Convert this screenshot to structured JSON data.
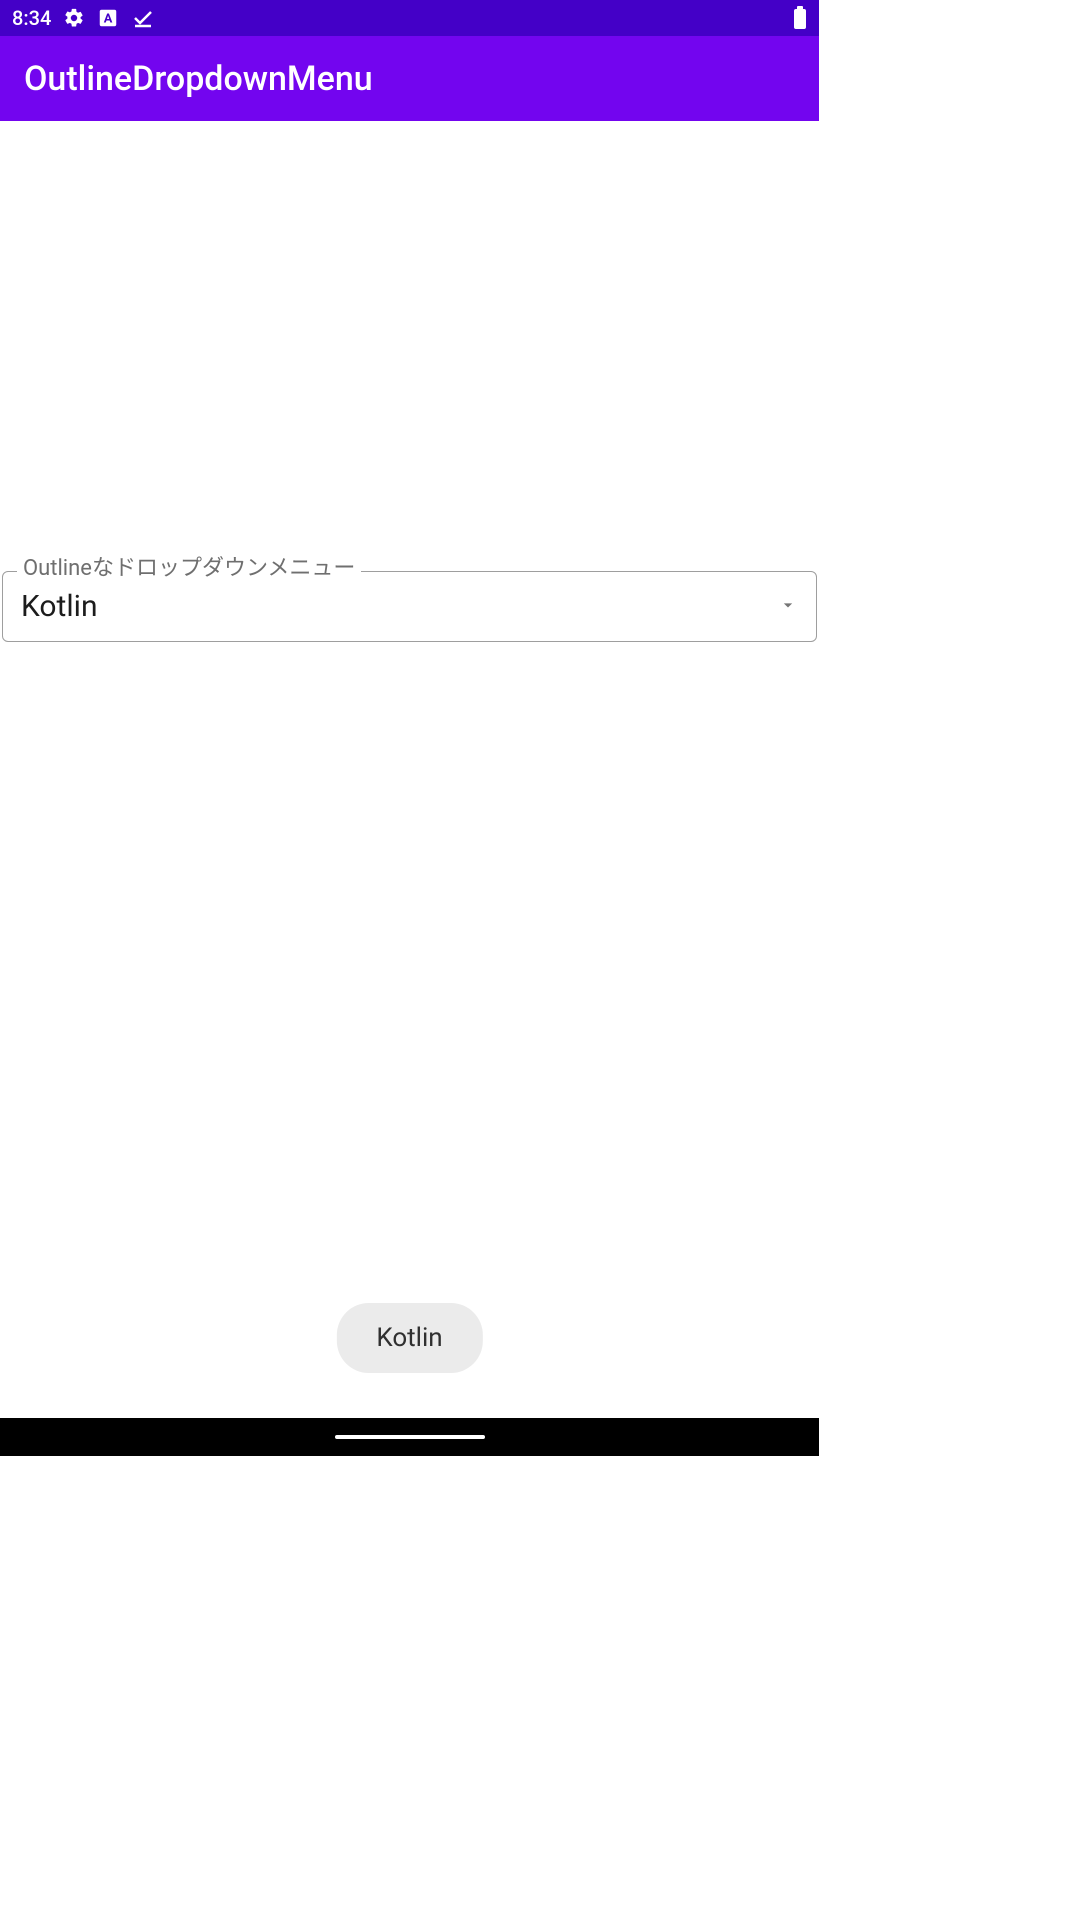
{
  "status_bar": {
    "time": "8:34"
  },
  "app_bar": {
    "title": "OutlineDropdownMenu"
  },
  "dropdown": {
    "label": "Outlineなドロップダウンメニュー",
    "selected_value": "Kotlin"
  },
  "snackbar": {
    "text": "Kotlin"
  }
}
